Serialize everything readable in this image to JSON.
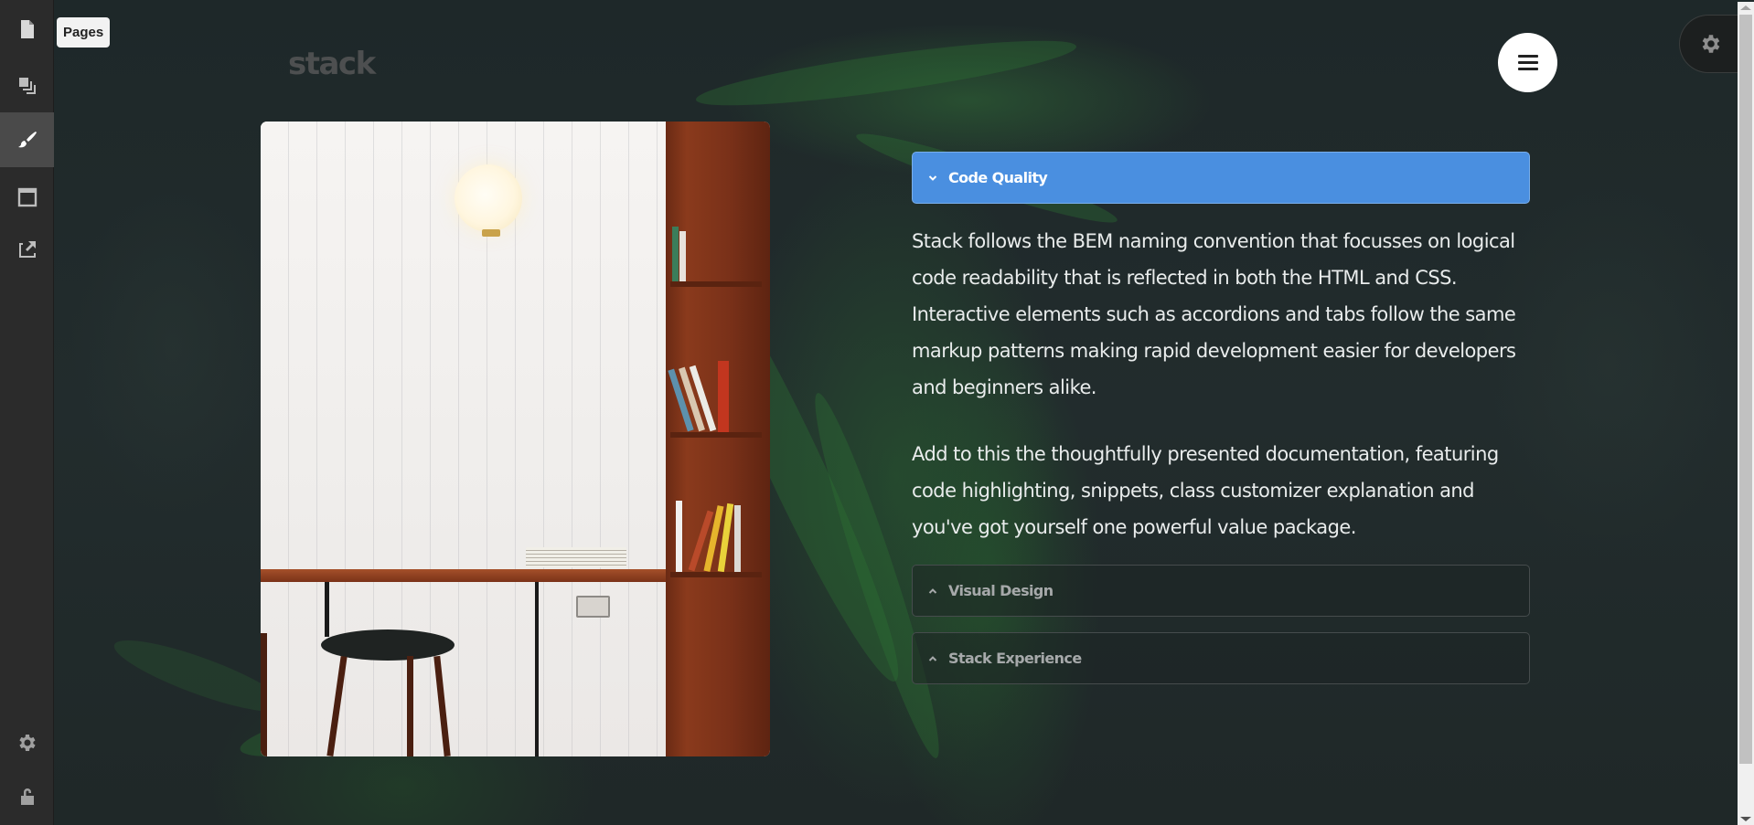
{
  "sidebar": {
    "items": [
      {
        "name": "pages",
        "icon": "document-icon",
        "active": false
      },
      {
        "name": "sections",
        "icon": "layers-icon",
        "active": false
      },
      {
        "name": "style",
        "icon": "brush-icon",
        "active": true
      },
      {
        "name": "layout",
        "icon": "window-icon",
        "active": false
      },
      {
        "name": "export",
        "icon": "external-link-icon",
        "active": false
      }
    ],
    "bottom_items": [
      {
        "name": "settings",
        "icon": "gear-icon"
      },
      {
        "name": "lock",
        "icon": "unlock-icon"
      }
    ],
    "tooltip": "Pages"
  },
  "header": {
    "logo": "stack",
    "menu_icon": "hamburger-icon",
    "settings_icon": "gear-icon"
  },
  "hero_image": {
    "alt": "Interior with white tiled wall, wooden desk, stool and bookshelf"
  },
  "accordion": {
    "accent_color": "#4a8fe0",
    "items": [
      {
        "title": "Code Quality",
        "expanded": true,
        "paragraphs": [
          "Stack follows the BEM naming convention that focusses on logical code readability that is reflected in both the HTML and CSS. Interactive elements such as accordions and tabs follow the same markup patterns making rapid development easier for developers and beginners alike.",
          "Add to this the thoughtfully presented documentation, featuring code highlighting, snippets, class customizer explanation and you've got yourself one powerful value package."
        ]
      },
      {
        "title": "Visual Design",
        "expanded": false
      },
      {
        "title": "Stack Experience",
        "expanded": false
      }
    ]
  }
}
